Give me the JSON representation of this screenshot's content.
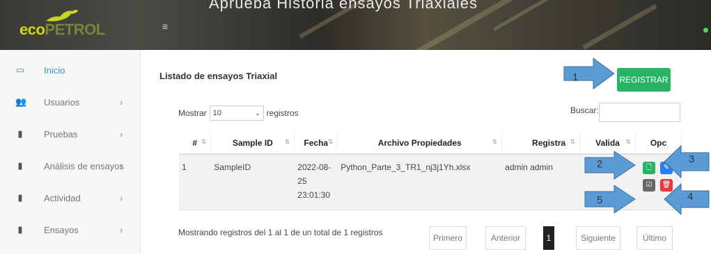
{
  "header": {
    "caption": "Aprueba   Historia ensayos Triaxiales",
    "logo_eco": "eco",
    "logo_petrol": "PETROL"
  },
  "sidebar": {
    "items": [
      {
        "label": "Inicio",
        "icon": "monitor-icon"
      },
      {
        "label": "Usuarios",
        "icon": "users-icon"
      },
      {
        "label": "Pruebas",
        "icon": "book-icon"
      },
      {
        "label": "Análisis de ensayos",
        "icon": "book-icon"
      },
      {
        "label": "Actividad",
        "icon": "book-icon"
      },
      {
        "label": "Ensayos",
        "icon": "book-icon"
      }
    ]
  },
  "main": {
    "title": "Listado de ensayos Triaxial",
    "register_button": "REGISTRAR",
    "show_label": "Mostrar",
    "show_value": "10",
    "records_label": "registros",
    "search_label": "Buscar:",
    "columns": [
      "#",
      "Sample ID",
      "Fecha",
      "Archivo Propiedades",
      "Registra",
      "Valida",
      "Opc"
    ],
    "rows": [
      {
        "num": "1",
        "sample_id": "SampleID",
        "fecha_date": "2022-08-25",
        "fecha_time": "23:01:30",
        "archivo": "Python_Parte_3_TR1_nj3j1Yh.xlsx",
        "registra": "admin admin",
        "valida": ""
      }
    ],
    "info": "Mostrando registros del 1 al 1 de un total de 1 registros",
    "pagination": [
      "Primero",
      "Anterior",
      "1",
      "Siguiente",
      "Último"
    ]
  },
  "annotations": [
    "1",
    "2",
    "3",
    "4",
    "5"
  ],
  "colors": {
    "accent": "#3c8dbc",
    "success": "#28b463",
    "primary": "#2b7de9",
    "danger": "#e23b3b",
    "arrow": "#5b9bd5"
  }
}
